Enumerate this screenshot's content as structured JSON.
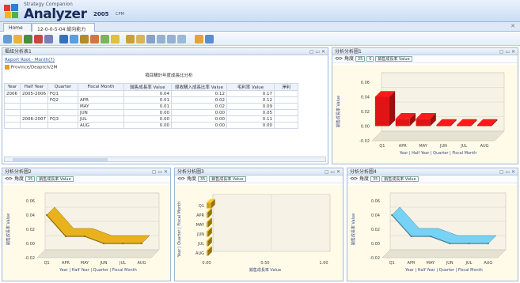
{
  "app": {
    "company": "Strategy Companion",
    "name": "Analyzer",
    "version": "2005",
    "version_sub": "CPM"
  },
  "tabs": [
    {
      "label": "Home"
    },
    {
      "label": "12-0-0-5-04 縱向能力分析"
    }
  ],
  "grid_panel": {
    "title": "樞紐分析表1",
    "breadcrumb": "Report Root - Month(7)",
    "cube": "Province/Deaptch/2M",
    "measure_group_title": "項目購計年度成長比分析",
    "columns": [
      "Year",
      "Half Year",
      "Quarter",
      "Fiscal Month",
      "銷售成長率 Value",
      "總收購入成長比率 Value",
      "毛利率 Value",
      "淨利"
    ],
    "rows": [
      {
        "year": "2006",
        "half": "2005-2006",
        "quarter": "FQ1",
        "month": "",
        "v1": "0.04",
        "v2": "0.12",
        "v3": "0.17"
      },
      {
        "year": "",
        "half": "",
        "quarter": "FQ2",
        "month": "APR",
        "v1": "0.01",
        "v2": "0.02",
        "v3": "0.12"
      },
      {
        "year": "",
        "half": "",
        "quarter": "",
        "month": "MAY",
        "v1": "0.01",
        "v2": "0.02",
        "v3": "0.09"
      },
      {
        "year": "",
        "half": "",
        "quarter": "",
        "month": "JUN",
        "v1": "0.00",
        "v2": "0.00",
        "v3": "0.05"
      },
      {
        "year": "",
        "half": "2006-2007",
        "quarter": "FQ3",
        "month": "JUL",
        "v1": "0.00",
        "v2": "0.00",
        "v3": "0.11"
      },
      {
        "year": "",
        "half": "",
        "quarter": "",
        "month": "AUG",
        "v1": "0.00",
        "v2": "0.00",
        "v3": "0.00"
      }
    ]
  },
  "chart_panels": [
    {
      "title": "分析分析圖1",
      "toolbar": "角度",
      "measure": "銷售成長率 Value",
      "ylabel": "銷售成長率 Value",
      "xlabel": "Year | Half Year | Quarter | Fiscal Month"
    },
    {
      "title": "分析分析圖2",
      "toolbar": "角度",
      "measure": "銷售成長率 Value",
      "ylabel": "銷售成長率 Value",
      "xlabel": "Year | Half Year | Quarter | Fiscal Month"
    },
    {
      "title": "分析分析圖3",
      "toolbar": "角度",
      "measure": "銷售成長率 Value",
      "ylabel": "Year | Quarter | Fiscal Month",
      "xlabel": "銷售成長率 Value"
    },
    {
      "title": "分析分析圖4",
      "toolbar": "角度",
      "measure": "銷售成長率 Value",
      "ylabel": "銷售成長率 Value",
      "xlabel": "Year | Half Year | Quarter | Fiscal Month"
    }
  ],
  "chart_data": [
    {
      "type": "bar",
      "title": "",
      "categories": [
        "Q1",
        "APR",
        "MAY",
        "JUN",
        "JUL",
        "AUG"
      ],
      "values": [
        0.04,
        0.01,
        0.01,
        0.0,
        0.0,
        0.0
      ],
      "ylim": [
        -0.02,
        0.06
      ],
      "yticks": [
        "0.06",
        "0.04",
        "0.02",
        "0.00",
        "-0.02"
      ],
      "color": "#e01414"
    },
    {
      "type": "area",
      "title": "",
      "categories": [
        "Q1",
        "APR",
        "MAY",
        "JUN",
        "JUL",
        "AUG"
      ],
      "values": [
        0.04,
        0.01,
        0.01,
        0.0,
        0.0,
        0.0
      ],
      "ylim": [
        -0.02,
        0.06
      ],
      "yticks": [
        "0.06",
        "0.04",
        "0.02",
        "0.00",
        "-0.02"
      ],
      "color": "#d4a21a"
    },
    {
      "type": "bar",
      "orientation": "horizontal",
      "title": "",
      "categories": [
        "Q1",
        "APR",
        "MAY",
        "JUN",
        "JUL",
        "AUG"
      ],
      "values": [
        0.04,
        0.01,
        0.01,
        0.0,
        0.0,
        0.0
      ],
      "xlim": [
        0.0,
        1.0
      ],
      "xticks": [
        "0.00",
        "0.50",
        "1.00"
      ],
      "color": "#d4a21a"
    },
    {
      "type": "area",
      "title": "",
      "categories": [
        "Q1",
        "APR",
        "MAY",
        "JUN",
        "JUL",
        "AUG"
      ],
      "values": [
        0.04,
        0.01,
        0.01,
        0.0,
        0.0,
        0.0
      ],
      "ylim": [
        -0.02,
        0.06
      ],
      "yticks": [
        "0.06",
        "0.04",
        "0.02",
        "0.00",
        "-0.02"
      ],
      "color": "#6cc0e0"
    }
  ]
}
